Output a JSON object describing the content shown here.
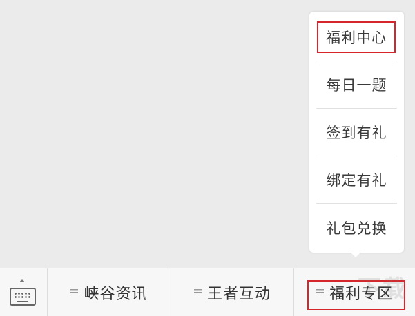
{
  "popup_menu": {
    "items": [
      {
        "label": "福利中心",
        "highlighted": true
      },
      {
        "label": "每日一题",
        "highlighted": false
      },
      {
        "label": "签到有礼",
        "highlighted": false
      },
      {
        "label": "绑定有礼",
        "highlighted": false
      },
      {
        "label": "礼包兑换",
        "highlighted": false
      }
    ]
  },
  "bottom_bar": {
    "keyboard_icon": "keyboard-icon",
    "tabs": [
      {
        "label": "峡谷资讯",
        "icon": "menu-lines-icon"
      },
      {
        "label": "王者互动",
        "icon": "menu-lines-icon"
      },
      {
        "label": "福利专区",
        "icon": "menu-lines-icon",
        "highlighted": true
      }
    ]
  },
  "colors": {
    "highlight": "#d6262b",
    "background": "#ebebeb",
    "bar_background": "#f7f7f7"
  }
}
